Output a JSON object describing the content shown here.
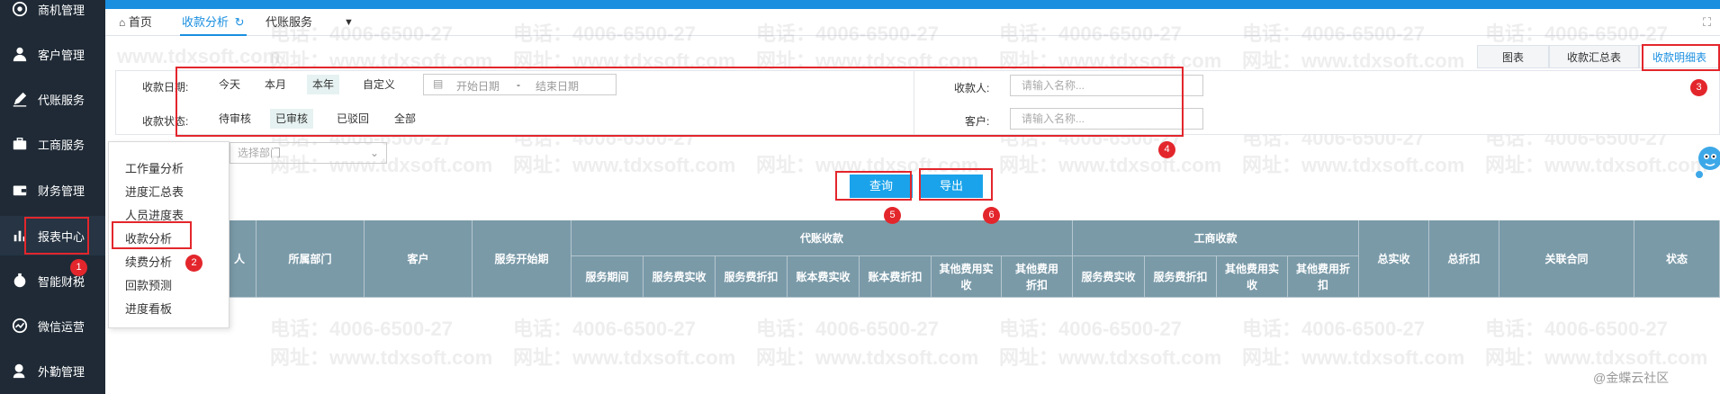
{
  "sidebar": {
    "items": [
      {
        "label": "商机管理",
        "icon": "target-icon"
      },
      {
        "label": "客户管理",
        "icon": "user-icon"
      },
      {
        "label": "代账服务",
        "icon": "pen-icon"
      },
      {
        "label": "工商服务",
        "icon": "briefcase-icon"
      },
      {
        "label": "财务管理",
        "icon": "wallet-icon"
      },
      {
        "label": "报表中心",
        "icon": "chart-icon"
      },
      {
        "label": "智能财税",
        "icon": "tax-icon"
      },
      {
        "label": "微信运营",
        "icon": "wechat-icon"
      },
      {
        "label": "外勤管理",
        "icon": "field-icon"
      }
    ]
  },
  "tabs": {
    "home": "首页",
    "active": "收款分析",
    "service": "代账服务"
  },
  "view_tabs": [
    "图表",
    "收款汇总表",
    "收款明细表"
  ],
  "filters": {
    "date_label": "收款日期:",
    "date_options": [
      "今天",
      "本月",
      "本年",
      "自定义"
    ],
    "date_selected": "本年",
    "start_placeholder": "开始日期",
    "dash": "-",
    "end_placeholder": "结束日期",
    "status_label": "收款状态:",
    "status_options": [
      "待审核",
      "已审核",
      "已驳回",
      "全部"
    ],
    "status_selected": "已审核",
    "payee_label": "收款人:",
    "payee_placeholder": "请输入名称...",
    "customer_label": "客户:",
    "customer_placeholder": "请输入名称...",
    "dept_placeholder": "选择部门"
  },
  "buttons": {
    "query": "查询",
    "export": "导出"
  },
  "table": {
    "single_headers": [
      "人",
      "所属部门",
      "客户",
      "服务开始期"
    ],
    "group1": "代账收款",
    "group1_cols": [
      "服务期间",
      "服务费实收",
      "服务费折扣",
      "账本费实收",
      "账本费折扣",
      "其他费用实收",
      "其他费用折扣"
    ],
    "group2": "工商收款",
    "group2_cols": [
      "服务费实收",
      "服务费折扣",
      "其他费用实收",
      "其他费用折扣"
    ],
    "tail_headers": [
      "总实收",
      "总折扣",
      "关联合同",
      "状态"
    ]
  },
  "menu": {
    "items": [
      "工作量分析",
      "进度汇总表",
      "人员进度表",
      "收款分析",
      "续费分析",
      "回款预测",
      "进度看板"
    ]
  },
  "annotations": [
    "1",
    "2",
    "3",
    "4",
    "5",
    "6"
  ],
  "watermark": {
    "phone": "电话：4006-6500-27",
    "site": "网址：www.tdxsoft.com",
    "site_short": "www.tdxsoft.com"
  },
  "footer_brand": "@金蝶云社区",
  "colors": {
    "sidebar_bg": "#1f2a36",
    "accent": "#1a8fe0",
    "button_blue": "#1aa3ea",
    "header_bg": "#7a9aa8",
    "annotation_red": "#e3262c"
  }
}
